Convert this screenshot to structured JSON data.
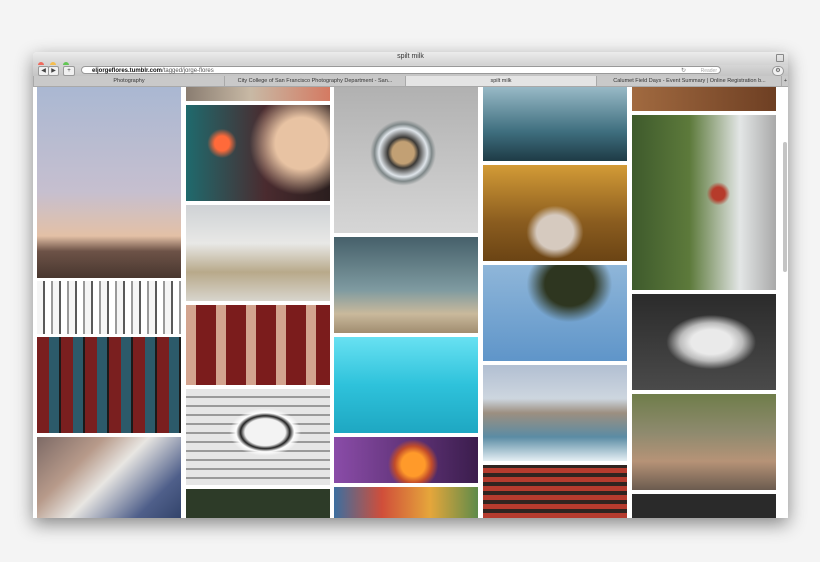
{
  "window": {
    "title": "spilt milk",
    "url_host": "eljorgeflores.tumblr.com",
    "url_path": "/tagged/jorge-flores",
    "reader_label": "Reader"
  },
  "tabs": [
    {
      "label": "Photography"
    },
    {
      "label": "City College of San Francisco Photography Department - San..."
    },
    {
      "label": "spilt milk"
    },
    {
      "label": "Calumet Field Days - Event Summary | Online Registration b..."
    }
  ],
  "colors": {
    "close": "#ef6a5e",
    "minimize": "#f5be4f",
    "zoom": "#62c655"
  }
}
